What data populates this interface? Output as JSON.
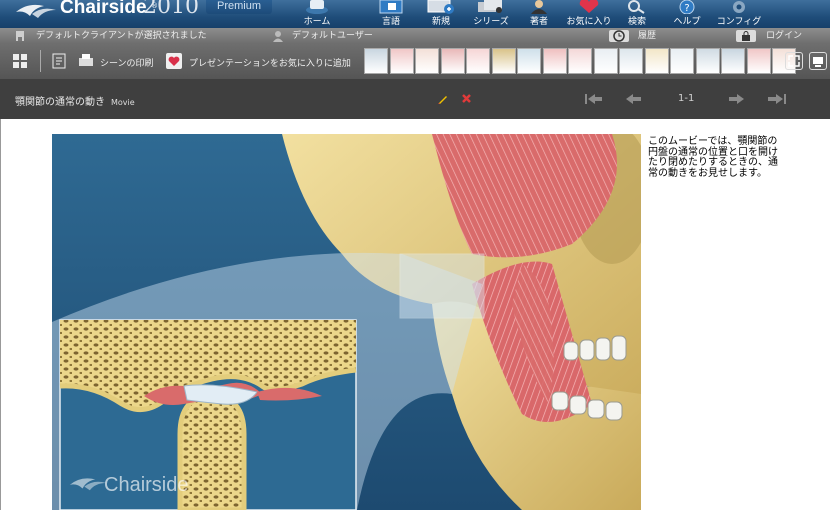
{
  "app": {
    "logo_text": "Chairside",
    "logo_tm": "®",
    "logo_year": "2010",
    "edition": "Premium"
  },
  "nav": [
    {
      "label": "ホーム",
      "icon": "home-icon"
    },
    {
      "label": "言語",
      "icon": "language-icon"
    },
    {
      "label": "新規",
      "icon": "new-icon"
    },
    {
      "label": "シリーズ",
      "icon": "series-icon"
    },
    {
      "label": "著者",
      "icon": "author-icon"
    },
    {
      "label": "お気に入り",
      "icon": "favorites-icon"
    },
    {
      "label": "検索",
      "icon": "search-icon"
    },
    {
      "label": "ヘルプ",
      "icon": "help-icon"
    },
    {
      "label": "コンフィグ",
      "icon": "config-icon"
    }
  ],
  "status": {
    "client": "デフォルトクライアントが選択されました",
    "user": "デフォルトユーザー",
    "history": "履歴",
    "login": "ログイン"
  },
  "toolbar": {
    "print_scene": "シーンの印刷",
    "add_favorite": "プレゼンテーションをお気に入りに追加"
  },
  "movie": {
    "title": "顎関節の通常の動き",
    "type": "Movie",
    "page": "1-1",
    "description": "このムービーでは、顎関節の円盤の通常の位置と口を開けたり閉めたりするときの、通常の動きをお見せします。",
    "watermark": "Chairside"
  },
  "colors": {
    "header_blue": "#1f4d7a",
    "bone": "#e8d48a",
    "muscle": "#d9706f",
    "background_blue": "#2e5f86"
  }
}
